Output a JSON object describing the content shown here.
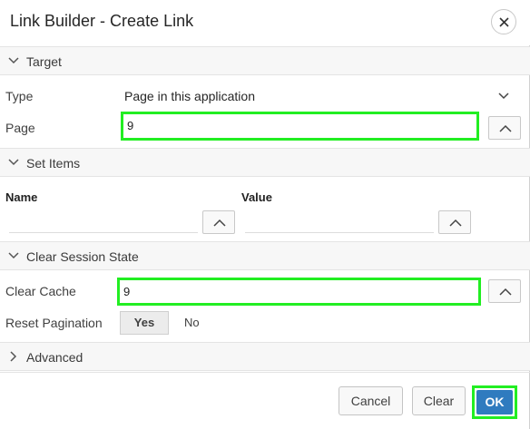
{
  "dialog": {
    "title": "Link Builder - Create Link",
    "close_icon": "close-icon"
  },
  "target": {
    "section_label": "Target",
    "type_label": "Type",
    "type_value": "Page in this application",
    "page_label": "Page",
    "page_value": "9"
  },
  "set_items": {
    "section_label": "Set Items",
    "name_header": "Name",
    "value_header": "Value"
  },
  "clear_session": {
    "section_label": "Clear Session State",
    "clear_cache_label": "Clear Cache",
    "clear_cache_value": "9",
    "reset_pagination_label": "Reset Pagination",
    "yes_label": "Yes",
    "no_label": "No"
  },
  "advanced": {
    "section_label": "Advanced"
  },
  "footer": {
    "cancel_label": "Cancel",
    "clear_label": "Clear",
    "ok_label": "OK"
  },
  "colors": {
    "highlight": "#22ee22",
    "primary": "#2f7bbf"
  }
}
